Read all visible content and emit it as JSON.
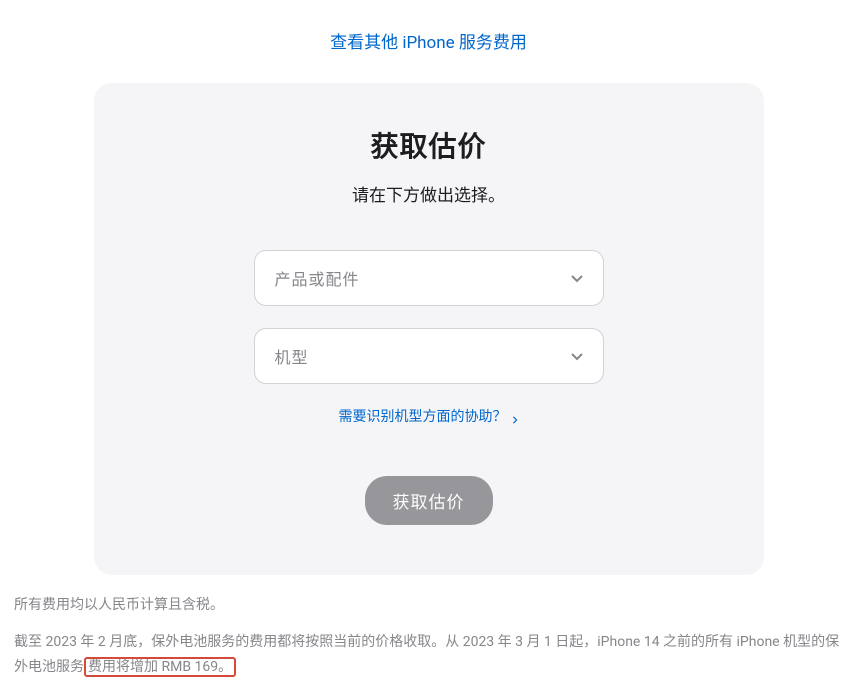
{
  "topLink": "查看其他 iPhone 服务费用",
  "card": {
    "title": "获取估价",
    "subtitle": "请在下方做出选择。",
    "select1": "产品或配件",
    "select2": "机型",
    "helpLink": "需要识别机型方面的协助？",
    "submitBtn": "获取估价"
  },
  "footer": {
    "line1": "所有费用均以人民币计算且含税。",
    "line2_a": "截至 2023 年 2 月底，保外电池服务的费用都将按照当前的价格收取。从 2023 年 3 月 1 日起，iPhone 14 之前的所有 iPhone 机型的保外电池服务",
    "line2_b": "费用将增加 RMB 169。"
  }
}
